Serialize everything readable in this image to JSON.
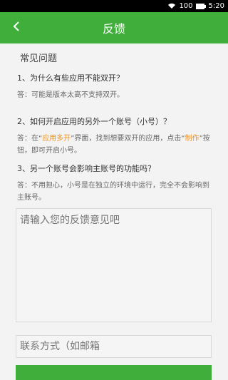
{
  "status": {
    "battery": "100",
    "time": "5:20"
  },
  "header": {
    "title": "反馈",
    "back_icon": "chevron-left-icon"
  },
  "faq": {
    "title": "常见问题",
    "items": [
      {
        "q": "1、为什么有些应用不能双开？",
        "a": "答：可能是版本太高不支持双开。"
      },
      {
        "q": "2、如何开启应用的另外一个账号（小号）？",
        "a_pre": "答：在“",
        "a_hl1": "应用多开",
        "a_mid": "”界面，找到想要双开的应用，点击“",
        "a_hl2": "制作",
        "a_post": "”按钮，即可开启小号。"
      },
      {
        "q": "3、另一个账号会影响主账号的功能吗？",
        "a": "答：不用担心，小号是在独立的环境中运行，完全不会影响到主账号。"
      }
    ]
  },
  "form": {
    "feedback_placeholder": "请输入您的反馈意见吧",
    "contact_placeholder": "联系方式（如邮箱"
  },
  "colors": {
    "accent": "#3fae3a",
    "highlight": "#e8952b"
  }
}
